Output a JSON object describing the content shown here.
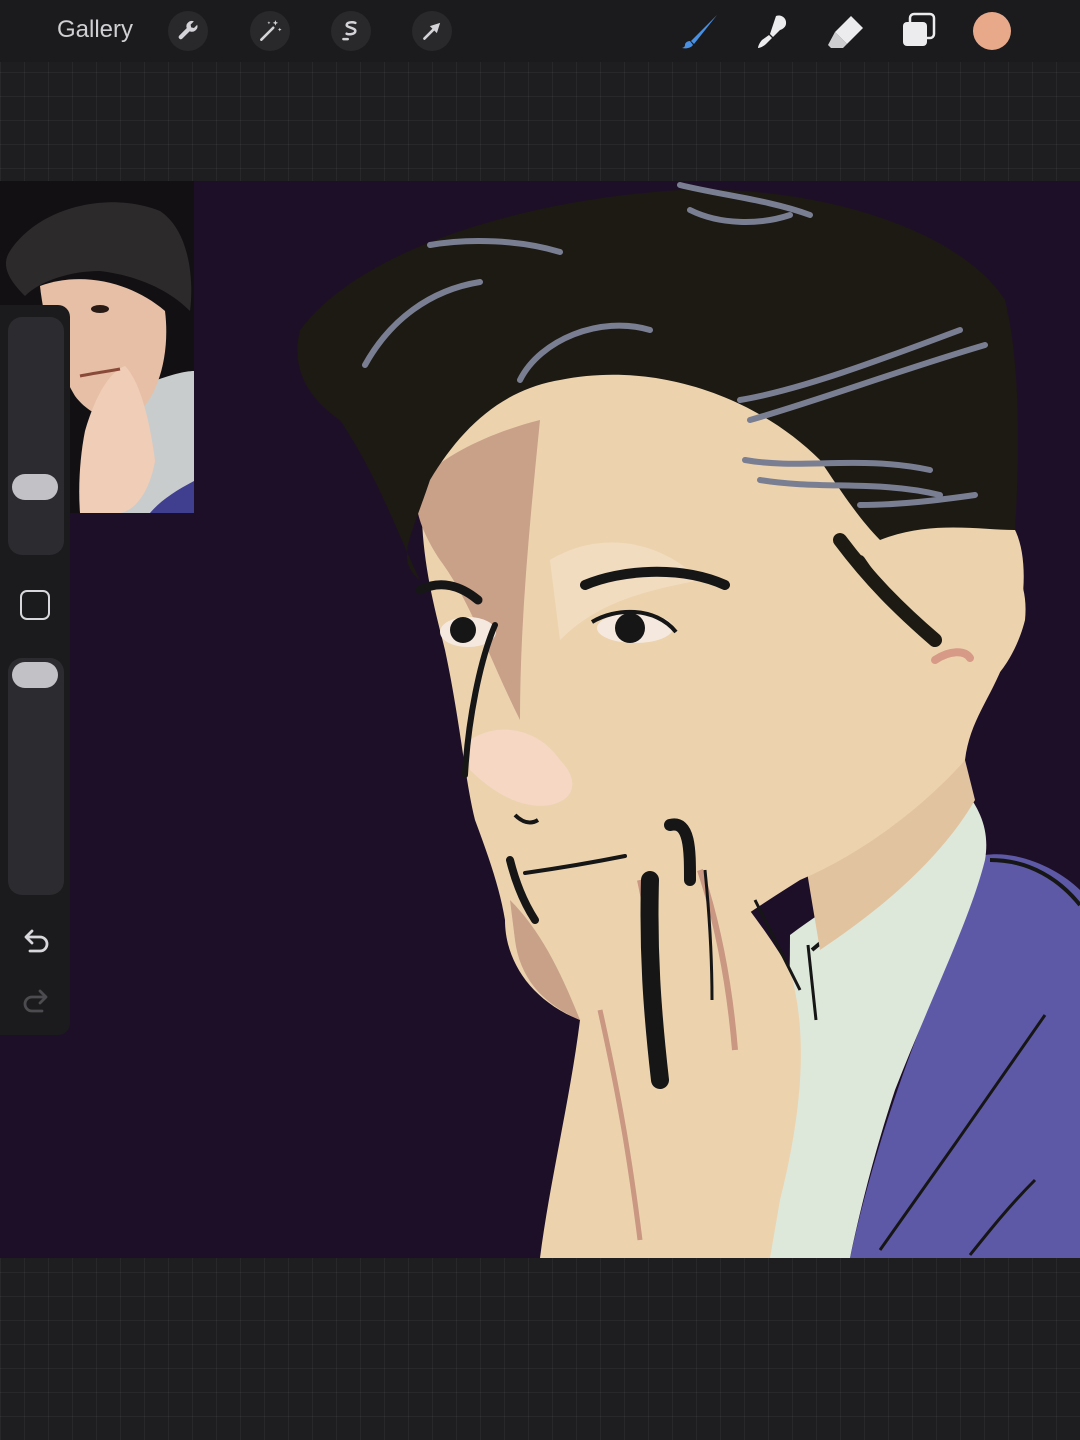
{
  "toolbar": {
    "gallery_label": "Gallery",
    "actions": [
      {
        "icon": "wrench-icon",
        "name": "actions-button"
      },
      {
        "icon": "magic-wand-icon",
        "name": "adjustments-button"
      },
      {
        "icon": "selection-icon",
        "name": "selection-button"
      },
      {
        "icon": "transform-arrow-icon",
        "name": "transform-button"
      }
    ],
    "tools": [
      {
        "icon": "brush-icon",
        "name": "brush-tool",
        "active": true
      },
      {
        "icon": "smudge-icon",
        "name": "smudge-tool",
        "active": false
      },
      {
        "icon": "eraser-icon",
        "name": "eraser-tool",
        "active": false
      },
      {
        "icon": "layers-icon",
        "name": "layers-button",
        "active": false
      }
    ],
    "current_color": "#e8a98b"
  },
  "sidebar": {
    "brush_size_level": 0.25,
    "opacity_level": 1.0,
    "undo_icon": "undo-icon",
    "redo_icon": "redo-icon",
    "redo_enabled": false
  },
  "colors": {
    "canvas_background": "#1e0f29",
    "hair": "#1c1a12",
    "skin": "#ecd3ae",
    "shirt": "#dde8db",
    "jacket": "#5e59a6",
    "accent_blue": "#4a90e2"
  }
}
